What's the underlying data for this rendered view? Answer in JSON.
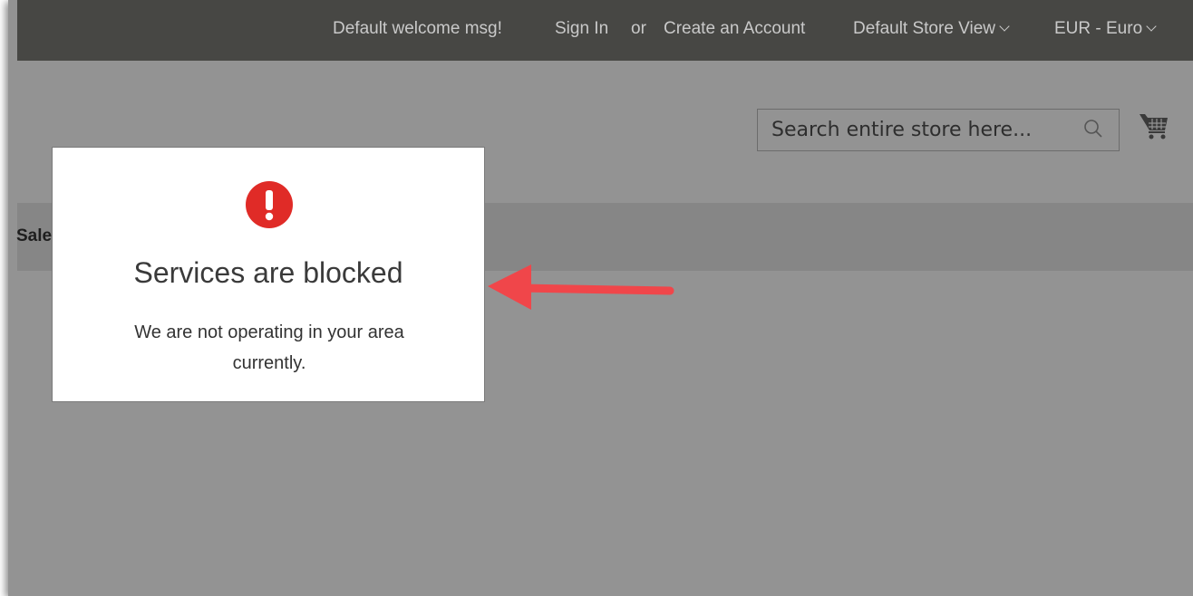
{
  "header": {
    "welcome": "Default welcome msg!",
    "sign_in": "Sign In",
    "or": "or",
    "create_account": "Create an Account",
    "store_view": "Default Store View",
    "currency": "EUR - Euro"
  },
  "search": {
    "placeholder": "Search entire store here..."
  },
  "nav": {
    "item": "Sale"
  },
  "modal": {
    "title": "Services are blocked",
    "message": "We are not operating in your area currently."
  },
  "colors": {
    "alert_red": "#e02b27",
    "arrow_red": "#f0464a",
    "overlay_gray": "#939393",
    "topbar": "#474744"
  },
  "icons": [
    "search-icon",
    "cart-icon",
    "alert-icon",
    "arrow-annotation"
  ]
}
